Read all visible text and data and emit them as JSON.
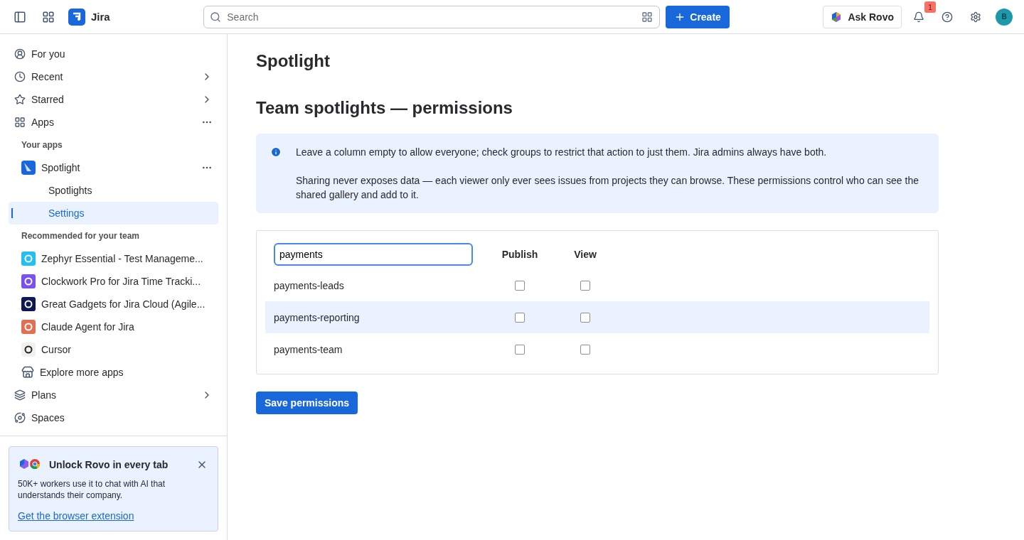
{
  "topbar": {
    "product": "Jira",
    "search": {
      "placeholder": "Search"
    },
    "create": "Create",
    "ask": "Ask Rovo",
    "notifications": "1",
    "avatar": "B"
  },
  "sidebar": {
    "top_items": [
      {
        "label": "For you",
        "chevron": false,
        "more": false
      },
      {
        "label": "Recent",
        "chevron": true,
        "more": false
      },
      {
        "label": "Starred",
        "chevron": true,
        "more": false
      },
      {
        "label": "Apps",
        "chevron": false,
        "more": true
      }
    ],
    "your_apps_heading": "Your apps",
    "app": {
      "label": "Spotlight",
      "children": [
        {
          "label": "Spotlights",
          "selected": false
        },
        {
          "label": "Settings",
          "selected": true
        }
      ]
    },
    "recommended_heading": "Recommended for your team",
    "recommended": [
      {
        "label": "Zephyr Essential - Test Manageme..."
      },
      {
        "label": "Clockwork Pro for Jira Time Tracki..."
      },
      {
        "label": "Great Gadgets for Jira Cloud (Agile..."
      },
      {
        "label": "Claude Agent for Jira"
      },
      {
        "label": "Cursor"
      },
      {
        "label": "Explore more apps"
      }
    ],
    "bottom_items": [
      {
        "label": "Plans",
        "chevron": true,
        "more": false
      },
      {
        "label": "Spaces",
        "chevron": false,
        "more": false
      }
    ],
    "promo": {
      "title": "Unlock Rovo in every tab",
      "body": "50K+ workers use it to chat with AI that understands their company.",
      "link": "Get the browser extension"
    }
  },
  "main": {
    "title": "Spotlight",
    "section_title": "Team spotlights — permissions",
    "info": [
      "Leave a column empty to allow everyone; check groups to restrict that action to just them. Jira admins always have both.",
      "Sharing never exposes data — each viewer only ever sees issues from projects they can browse. These permissions control who can see the shared gallery and add to it."
    ],
    "filter": {
      "value": "payments"
    },
    "columns": [
      "Publish",
      "View"
    ],
    "rows": [
      {
        "group": "payments-leads",
        "highlighted": false,
        "publish": false,
        "view": false
      },
      {
        "group": "payments-reporting",
        "highlighted": true,
        "publish": false,
        "view": false
      },
      {
        "group": "payments-team",
        "highlighted": false,
        "publish": false,
        "view": false
      }
    ],
    "save": "Save permissions"
  }
}
